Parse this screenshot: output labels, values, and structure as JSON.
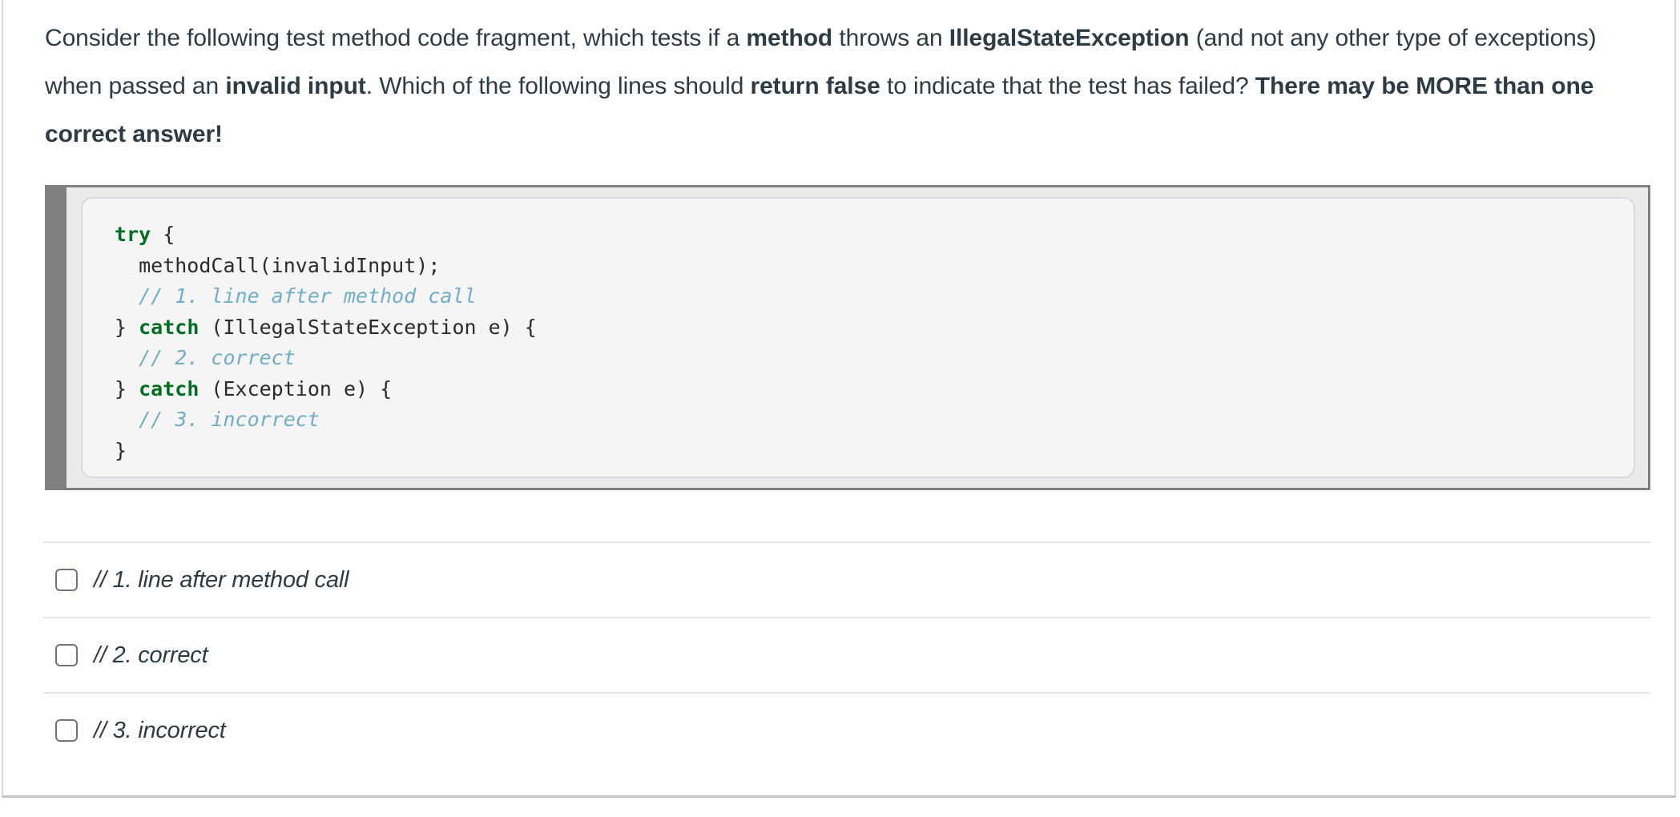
{
  "question": {
    "segments": [
      {
        "text": "Consider the following test method code fragment, which tests if a ",
        "bold": false
      },
      {
        "text": "method",
        "bold": true
      },
      {
        "text": " throws an ",
        "bold": false
      },
      {
        "text": "IllegalStateException",
        "bold": true
      },
      {
        "text": " (and not any other type of exceptions) when passed an ",
        "bold": false
      },
      {
        "text": "invalid input",
        "bold": true
      },
      {
        "text": ". Which of the following lines should ",
        "bold": false
      },
      {
        "text": "return false",
        "bold": true
      },
      {
        "text": " to indicate that the test has failed? ",
        "bold": false
      },
      {
        "text": "There may be MORE than one correct answer!",
        "bold": true
      }
    ],
    "plain": "Consider the following test method code fragment, which tests if a method throws an IllegalStateException (and not any other type of exceptions) when passed an invalid input. Which of the following lines should return false to indicate that the test has failed? There may be MORE than one correct answer!"
  },
  "code_block": {
    "language": "java",
    "lines": [
      {
        "tokens": [
          {
            "t": "try",
            "c": "kw"
          },
          {
            "t": " {",
            "c": "plain"
          }
        ]
      },
      {
        "tokens": [
          {
            "t": "  methodCall(invalidInput);",
            "c": "plain"
          }
        ]
      },
      {
        "tokens": [
          {
            "t": "  ",
            "c": "plain"
          },
          {
            "t": "// 1. line after method call",
            "c": "cm"
          }
        ]
      },
      {
        "tokens": [
          {
            "t": "} ",
            "c": "plain"
          },
          {
            "t": "catch",
            "c": "kw"
          },
          {
            "t": " (IllegalStateException e) {",
            "c": "plain"
          }
        ]
      },
      {
        "tokens": [
          {
            "t": "  ",
            "c": "plain"
          },
          {
            "t": "// 2. correct",
            "c": "cm"
          }
        ]
      },
      {
        "tokens": [
          {
            "t": "} ",
            "c": "plain"
          },
          {
            "t": "catch",
            "c": "kw"
          },
          {
            "t": " (Exception e) {",
            "c": "plain"
          }
        ]
      },
      {
        "tokens": [
          {
            "t": "  ",
            "c": "plain"
          },
          {
            "t": "// 3. incorrect",
            "c": "cm"
          }
        ]
      },
      {
        "tokens": [
          {
            "t": "}",
            "c": "plain"
          }
        ]
      }
    ],
    "colors": {
      "keyword": "#007020",
      "comment": "#72adc8",
      "text": "#2b2b2b",
      "gutter_bar": "#808080",
      "outer_background": "#ebebeb",
      "inner_background": "#f5f5f5"
    }
  },
  "answers": {
    "options": [
      {
        "label": "// 1. line after method call",
        "checked": false
      },
      {
        "label": "// 2. correct",
        "checked": false
      },
      {
        "label": "// 3. incorrect",
        "checked": false
      }
    ]
  },
  "theme": {
    "text_color": "#2d3b45",
    "divider_color": "#e6e6e6",
    "card_border": "#d8d8d8"
  }
}
